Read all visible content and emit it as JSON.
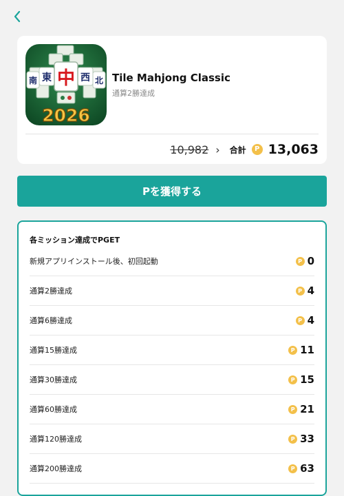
{
  "header": {
    "back_icon": "chevron-left-icon",
    "accent_color": "#1aa49b"
  },
  "app": {
    "title": "Tile Mahjong Classic",
    "subtitle": "通算2勝達成",
    "icon": {
      "name": "tile-mahjong-app-icon",
      "tile_char": "中",
      "winds": [
        "東",
        "南",
        "西",
        "北"
      ],
      "year": "2026"
    },
    "old_points": "10,982",
    "arrow": "›",
    "total_label": "合計",
    "coin_symbol": "P",
    "total_points": "13,063"
  },
  "cta": {
    "label": "Pを獲得する"
  },
  "missions": {
    "header": "各ミッション達成でPGET",
    "coin_symbol": "P",
    "items": [
      {
        "label": "新規アプリインストール後、初回起動",
        "points": "0"
      },
      {
        "label": "通算2勝達成",
        "points": "4"
      },
      {
        "label": "通算6勝達成",
        "points": "4"
      },
      {
        "label": "通算15勝達成",
        "points": "11"
      },
      {
        "label": "通算30勝達成",
        "points": "15"
      },
      {
        "label": "通算60勝達成",
        "points": "21"
      },
      {
        "label": "通算120勝達成",
        "points": "33"
      },
      {
        "label": "通算200勝達成",
        "points": "63"
      }
    ]
  }
}
